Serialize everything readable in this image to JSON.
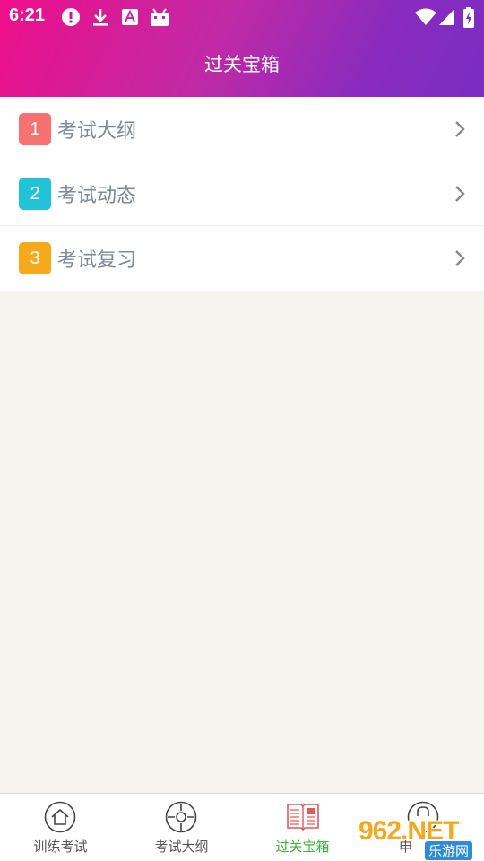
{
  "status_bar": {
    "time": "6:21",
    "icons": [
      "alert-icon",
      "download-icon",
      "font-icon",
      "android-icon",
      "wifi-icon",
      "signal-icon",
      "battery-icon"
    ]
  },
  "header": {
    "title": "过关宝箱"
  },
  "list": {
    "items": [
      {
        "number": "1",
        "label": "考试大纲",
        "color": "#f87171"
      },
      {
        "number": "2",
        "label": "考试动态",
        "color": "#22c3d9"
      },
      {
        "number": "3",
        "label": "考试复习",
        "color": "#f7a91c"
      }
    ]
  },
  "bottom_nav": {
    "items": [
      {
        "label": "训练考试",
        "icon": "home-icon"
      },
      {
        "label": "考试大纲",
        "icon": "crosshair-icon"
      },
      {
        "label": "过关宝箱",
        "icon": "news-icon",
        "active": true
      },
      {
        "label": "申",
        "icon": "lock-icon"
      }
    ],
    "active_color": "#3bb23b"
  },
  "watermark": {
    "main": "962.NET",
    "sub": "乐游网"
  },
  "colors": {
    "header_start": "#ee0f8a",
    "header_end": "#7a2cc3",
    "background": "#f6f4ee"
  }
}
